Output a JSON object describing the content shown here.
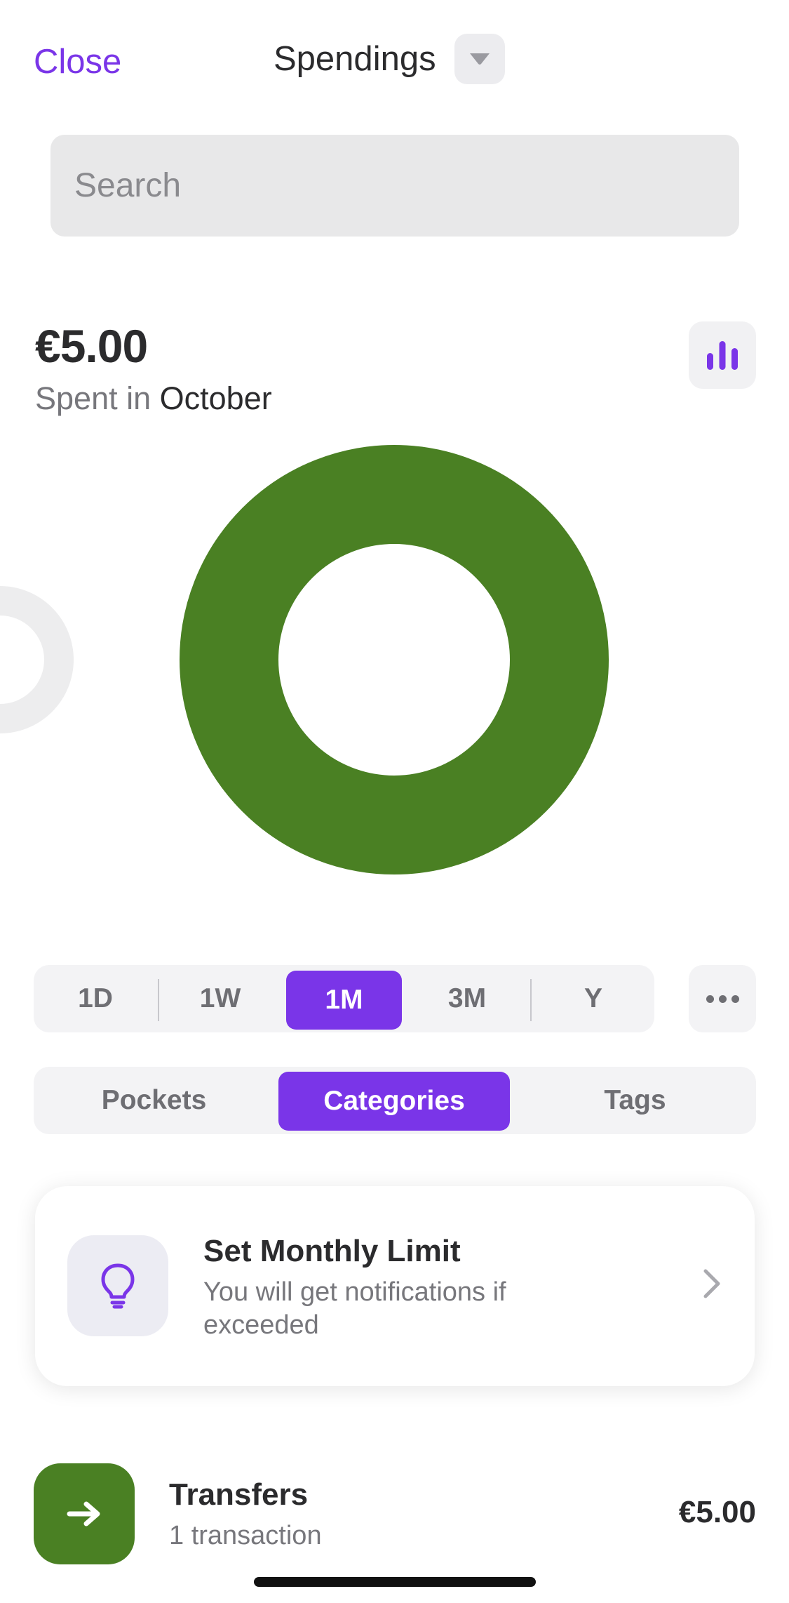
{
  "header": {
    "close_label": "Close",
    "title": "Spendings",
    "title_toggle_icon": "chevron-down-icon"
  },
  "search": {
    "placeholder": "Search"
  },
  "summary": {
    "amount": "€5.00",
    "spent_prefix": "Spent in",
    "month": "October",
    "chart_toggle_icon": "bar-chart-icon"
  },
  "chart_data": {
    "type": "pie",
    "categories": [
      "Transfers"
    ],
    "values": [
      5.0
    ],
    "colors": [
      "#4a8023"
    ]
  },
  "period_selector": {
    "options": [
      "1D",
      "1W",
      "1M",
      "3M",
      "Y"
    ],
    "selected": "1M",
    "more_icon": "ellipsis-icon"
  },
  "group_tabs": {
    "options": [
      "Pockets",
      "Categories",
      "Tags"
    ],
    "selected": "Categories"
  },
  "limit_card": {
    "icon": "lightbulb-icon",
    "title": "Set Monthly Limit",
    "subtitle": "You will get notifications if exceeded",
    "chevron_icon": "chevron-right-icon"
  },
  "transactions": [
    {
      "icon": "arrow-right-icon",
      "icon_color": "#4a8023",
      "name": "Transfers",
      "count": "1 transaction",
      "amount": "€5.00"
    }
  ],
  "colors": {
    "accent": "#7a35e8",
    "category_green": "#4a8023"
  }
}
